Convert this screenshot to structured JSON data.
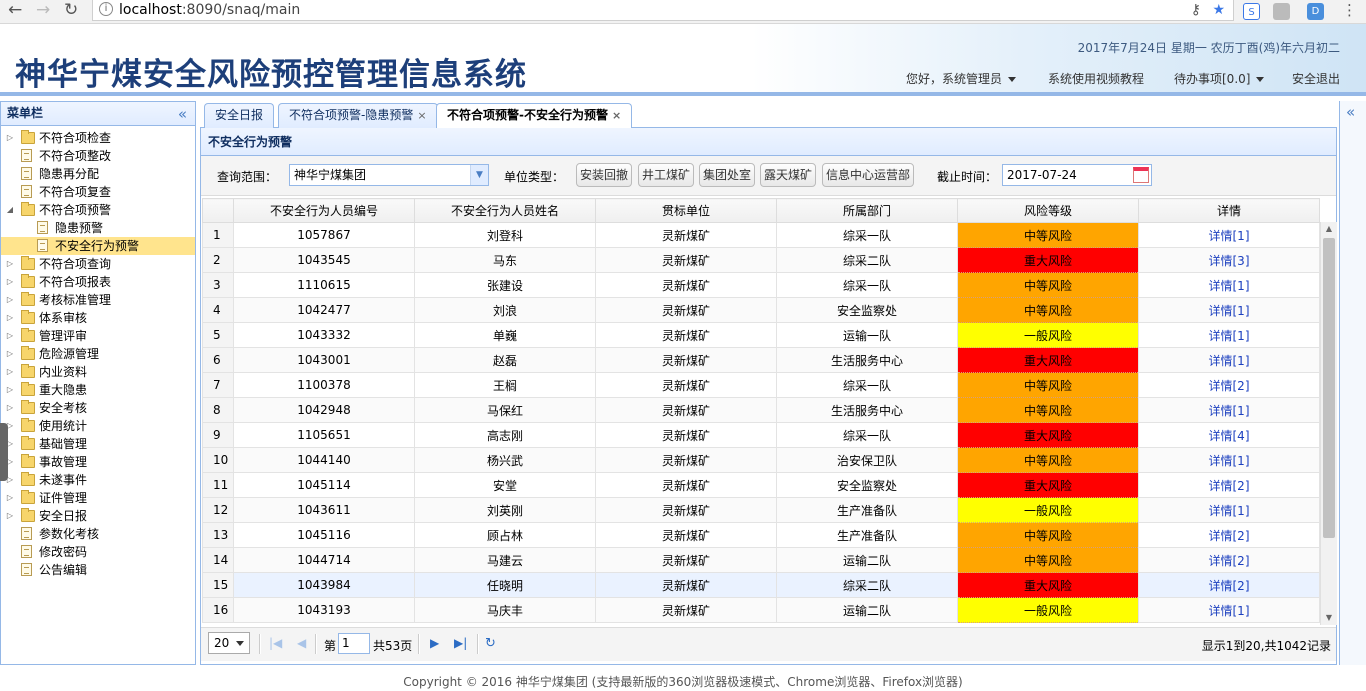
{
  "browser": {
    "url_host": "localhost",
    "url_rest": ":8090/snaq/main",
    "ext_labels": [
      "S",
      "D"
    ]
  },
  "header": {
    "title": "神华宁煤安全风险预控管理信息系统",
    "date": "2017年7月24日 星期一 农历丁酉(鸡)年六月初二",
    "greeting": "您好，系统管理员",
    "video_tutorial": "系统使用视频教程",
    "todo": "待办事项[0.0]",
    "logout": "安全退出"
  },
  "sidebar": {
    "title": "菜单栏",
    "items": [
      {
        "label": "不符合项检查",
        "type": "folder",
        "level": 0,
        "toggle": "▷"
      },
      {
        "label": "不符合项整改",
        "type": "file",
        "level": 0,
        "toggle": ""
      },
      {
        "label": "隐患再分配",
        "type": "file",
        "level": 0,
        "toggle": ""
      },
      {
        "label": "不符合项复查",
        "type": "file",
        "level": 0,
        "toggle": ""
      },
      {
        "label": "不符合项预警",
        "type": "folder",
        "level": 0,
        "toggle": "◢"
      },
      {
        "label": "隐患预警",
        "type": "file",
        "level": 1,
        "toggle": ""
      },
      {
        "label": "不安全行为预警",
        "type": "file",
        "level": 1,
        "toggle": "",
        "selected": true
      },
      {
        "label": "不符合项查询",
        "type": "folder",
        "level": 0,
        "toggle": "▷"
      },
      {
        "label": "不符合项报表",
        "type": "folder",
        "level": 0,
        "toggle": "▷"
      },
      {
        "label": "考核标准管理",
        "type": "folder",
        "level": 0,
        "toggle": "▷"
      },
      {
        "label": "体系审核",
        "type": "folder",
        "level": 0,
        "toggle": "▷"
      },
      {
        "label": "管理评审",
        "type": "folder",
        "level": 0,
        "toggle": "▷"
      },
      {
        "label": "危险源管理",
        "type": "folder",
        "level": 0,
        "toggle": "▷"
      },
      {
        "label": "内业资料",
        "type": "folder",
        "level": 0,
        "toggle": "▷"
      },
      {
        "label": "重大隐患",
        "type": "folder",
        "level": 0,
        "toggle": "▷"
      },
      {
        "label": "安全考核",
        "type": "folder",
        "level": 0,
        "toggle": "▷"
      },
      {
        "label": "使用统计",
        "type": "folder",
        "level": 0,
        "toggle": "▷"
      },
      {
        "label": "基础管理",
        "type": "folder",
        "level": 0,
        "toggle": "▷"
      },
      {
        "label": "事故管理",
        "type": "folder",
        "level": 0,
        "toggle": "▷"
      },
      {
        "label": "未遂事件",
        "type": "folder",
        "level": 0,
        "toggle": "▷"
      },
      {
        "label": "证件管理",
        "type": "folder",
        "level": 0,
        "toggle": "▷"
      },
      {
        "label": "安全日报",
        "type": "folder",
        "level": 0,
        "toggle": "▷"
      },
      {
        "label": "参数化考核",
        "type": "file",
        "level": 0,
        "toggle": ""
      },
      {
        "label": "修改密码",
        "type": "file",
        "level": 0,
        "toggle": ""
      },
      {
        "label": "公告编辑",
        "type": "file",
        "level": 0,
        "toggle": ""
      }
    ]
  },
  "tabs": [
    {
      "label": "安全日报",
      "closable": false,
      "active": false
    },
    {
      "label": "不符合项预警-隐患预警",
      "closable": true,
      "active": false
    },
    {
      "label": "不符合项预警-不安全行为预警",
      "closable": true,
      "active": true
    }
  ],
  "panel": {
    "title": "不安全行为预警",
    "scope_label": "查询范围：",
    "scope_value": "神华宁煤集团",
    "unit_type_label": "单位类型：",
    "unit_buttons": [
      "安装回撤",
      "井工煤矿",
      "集团处室",
      "露天煤矿",
      "信息中心运营部"
    ],
    "deadline_label": "截止时间：",
    "deadline_value": "2017-07-24"
  },
  "table": {
    "columns": [
      "不安全行为人员编号",
      "不安全行为人员姓名",
      "贯标单位",
      "所属部门",
      "风险等级",
      "详情"
    ],
    "rows": [
      {
        "n": "1",
        "id": "1057867",
        "name": "刘登科",
        "unit": "灵新煤矿",
        "dept": "综采一队",
        "risk": "中等风险",
        "detail": "详情[1]"
      },
      {
        "n": "2",
        "id": "1043545",
        "name": "马东",
        "unit": "灵新煤矿",
        "dept": "综采二队",
        "risk": "重大风险",
        "detail": "详情[3]"
      },
      {
        "n": "3",
        "id": "1110615",
        "name": "张建设",
        "unit": "灵新煤矿",
        "dept": "综采一队",
        "risk": "中等风险",
        "detail": "详情[1]"
      },
      {
        "n": "4",
        "id": "1042477",
        "name": "刘浪",
        "unit": "灵新煤矿",
        "dept": "安全监察处",
        "risk": "中等风险",
        "detail": "详情[1]"
      },
      {
        "n": "5",
        "id": "1043332",
        "name": "单巍",
        "unit": "灵新煤矿",
        "dept": "运输一队",
        "risk": "一般风险",
        "detail": "详情[1]"
      },
      {
        "n": "6",
        "id": "1043001",
        "name": "赵磊",
        "unit": "灵新煤矿",
        "dept": "生活服务中心",
        "risk": "重大风险",
        "detail": "详情[1]"
      },
      {
        "n": "7",
        "id": "1100378",
        "name": "王榈",
        "unit": "灵新煤矿",
        "dept": "综采一队",
        "risk": "中等风险",
        "detail": "详情[2]"
      },
      {
        "n": "8",
        "id": "1042948",
        "name": "马保红",
        "unit": "灵新煤矿",
        "dept": "生活服务中心",
        "risk": "中等风险",
        "detail": "详情[1]"
      },
      {
        "n": "9",
        "id": "1105651",
        "name": "高志刚",
        "unit": "灵新煤矿",
        "dept": "综采一队",
        "risk": "重大风险",
        "detail": "详情[4]"
      },
      {
        "n": "10",
        "id": "1044140",
        "name": "杨兴武",
        "unit": "灵新煤矿",
        "dept": "治安保卫队",
        "risk": "中等风险",
        "detail": "详情[1]"
      },
      {
        "n": "11",
        "id": "1045114",
        "name": "安堂",
        "unit": "灵新煤矿",
        "dept": "安全监察处",
        "risk": "重大风险",
        "detail": "详情[2]"
      },
      {
        "n": "12",
        "id": "1043611",
        "name": "刘英刚",
        "unit": "灵新煤矿",
        "dept": "生产准备队",
        "risk": "一般风险",
        "detail": "详情[1]"
      },
      {
        "n": "13",
        "id": "1045116",
        "name": "顾占林",
        "unit": "灵新煤矿",
        "dept": "生产准备队",
        "risk": "中等风险",
        "detail": "详情[2]"
      },
      {
        "n": "14",
        "id": "1044714",
        "name": "马建云",
        "unit": "灵新煤矿",
        "dept": "运输二队",
        "risk": "中等风险",
        "detail": "详情[2]"
      },
      {
        "n": "15",
        "id": "1043984",
        "name": "任晓明",
        "unit": "灵新煤矿",
        "dept": "综采二队",
        "risk": "重大风险",
        "detail": "详情[2]",
        "highlight": true
      },
      {
        "n": "16",
        "id": "1043193",
        "name": "马庆丰",
        "unit": "灵新煤矿",
        "dept": "运输二队",
        "risk": "一般风险",
        "detail": "详情[1]"
      }
    ]
  },
  "risk_colors": {
    "中等风险": "#ffa500",
    "重大风险": "#ff0000",
    "一般风险": "#ffff00"
  },
  "pager": {
    "page_size": "20",
    "page_prefix": "第",
    "current_page": "1",
    "total_pages": "共53页",
    "info": "显示1到20,共1042记录"
  },
  "footer": "Copyright © 2016 神华宁煤集团 (支持最新版的360浏览器极速模式、Chrome浏览器、Firefox浏览器)"
}
